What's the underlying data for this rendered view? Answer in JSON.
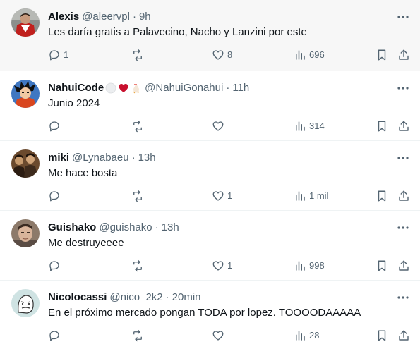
{
  "colors": {
    "text": "#0f1419",
    "muted": "#536471",
    "divider": "#eff3f4",
    "hover_bg": "#f7f7f7"
  },
  "tweets": [
    {
      "name": "Alexis",
      "handle": "@aleervpl",
      "separator": "·",
      "time": "9h",
      "text": "Les daría gratis a Palavecino, Nacho y Lanzini por este",
      "replies": "1",
      "retweets": "",
      "likes": "8",
      "views": "696",
      "avatar_icon": "avatar-red-jersey"
    },
    {
      "name": "NahuiCode",
      "handle": "@NahuiGonahui",
      "separator": "·",
      "time": "11h",
      "text": "Junio 2024",
      "replies": "",
      "retweets": "",
      "likes": "",
      "views": "314",
      "avatar_icon": "avatar-anime-character",
      "name_emojis": [
        "white-circle-icon",
        "red-heart-icon",
        "rooster-icon"
      ]
    },
    {
      "name": "miki",
      "handle": "@Lynabaeu",
      "separator": "·",
      "time": "13h",
      "text": "Me hace bosta",
      "replies": "",
      "retweets": "",
      "likes": "1",
      "views": "1 mil",
      "avatar_icon": "avatar-sepia-group"
    },
    {
      "name": "Guishako",
      "handle": "@guishako",
      "separator": "·",
      "time": "13h",
      "text": "Me destruyeeee",
      "replies": "",
      "retweets": "",
      "likes": "1",
      "views": "998",
      "avatar_icon": "avatar-face-photo"
    },
    {
      "name": "Nicolocassi",
      "handle": "@nico_2k2",
      "separator": "·",
      "time": "20min",
      "text": "En el próximo mercado pongan TODA por lopez. TOOOODAAAAA",
      "replies": "",
      "retweets": "",
      "likes": "",
      "views": "28",
      "avatar_icon": "avatar-meme-face"
    }
  ]
}
